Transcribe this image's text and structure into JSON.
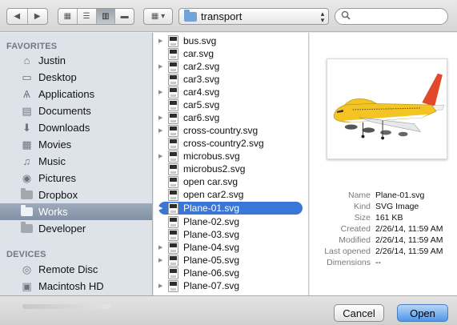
{
  "toolbar": {
    "back_icon": "back-arrow-icon",
    "forward_icon": "forward-arrow-icon",
    "path_folder": "transport",
    "search_placeholder": ""
  },
  "sidebar": {
    "favorites_header": "FAVORITES",
    "favorites": [
      {
        "label": "Justin",
        "icon": "home-icon"
      },
      {
        "label": "Desktop",
        "icon": "desktop-icon"
      },
      {
        "label": "Applications",
        "icon": "applications-icon"
      },
      {
        "label": "Documents",
        "icon": "documents-icon"
      },
      {
        "label": "Downloads",
        "icon": "downloads-icon"
      },
      {
        "label": "Movies",
        "icon": "movies-icon"
      },
      {
        "label": "Music",
        "icon": "music-icon"
      },
      {
        "label": "Pictures",
        "icon": "pictures-icon"
      },
      {
        "label": "Dropbox",
        "icon": "folder-icon"
      },
      {
        "label": "Works",
        "icon": "folder-icon",
        "selected": true
      },
      {
        "label": "Developer",
        "icon": "folder-icon"
      }
    ],
    "devices_header": "DEVICES",
    "devices": [
      {
        "label": "Remote Disc",
        "icon": "disc-icon"
      },
      {
        "label": "Macintosh HD",
        "icon": "hard-drive-icon"
      }
    ]
  },
  "files": [
    {
      "name": "bus.svg",
      "expandable": true
    },
    {
      "name": "car.svg",
      "expandable": false
    },
    {
      "name": "car2.svg",
      "expandable": true
    },
    {
      "name": "car3.svg",
      "expandable": false
    },
    {
      "name": "car4.svg",
      "expandable": true
    },
    {
      "name": "car5.svg",
      "expandable": false
    },
    {
      "name": "car6.svg",
      "expandable": true
    },
    {
      "name": "cross-country.svg",
      "expandable": true
    },
    {
      "name": "cross-country2.svg",
      "expandable": false
    },
    {
      "name": "microbus.svg",
      "expandable": true
    },
    {
      "name": "microbus2.svg",
      "expandable": false
    },
    {
      "name": "open car.svg",
      "expandable": false
    },
    {
      "name": "open car2.svg",
      "expandable": false
    },
    {
      "name": "Plane-01.svg",
      "expandable": true,
      "selected": true
    },
    {
      "name": "Plane-02.svg",
      "expandable": false
    },
    {
      "name": "Plane-03.svg",
      "expandable": false
    },
    {
      "name": "Plane-04.svg",
      "expandable": true
    },
    {
      "name": "Plane-05.svg",
      "expandable": true
    },
    {
      "name": "Plane-06.svg",
      "expandable": false
    },
    {
      "name": "Plane-07.svg",
      "expandable": true
    }
  ],
  "preview": {
    "info": [
      {
        "key": "Name",
        "value": "Plane-01.svg"
      },
      {
        "key": "Kind",
        "value": "SVG Image"
      },
      {
        "key": "Size",
        "value": "161 KB"
      },
      {
        "key": "Created",
        "value": "2/26/14, 11:59 AM"
      },
      {
        "key": "Modified",
        "value": "2/26/14, 11:59 AM"
      },
      {
        "key": "Last opened",
        "value": "2/26/14, 11:59 AM"
      },
      {
        "key": "Dimensions",
        "value": "--"
      }
    ]
  },
  "buttons": {
    "cancel": "Cancel",
    "open": "Open"
  },
  "colors": {
    "selection": "#3a76d5",
    "sidebar_bg": "#dee3ea",
    "open_button": "#4e96e8"
  }
}
